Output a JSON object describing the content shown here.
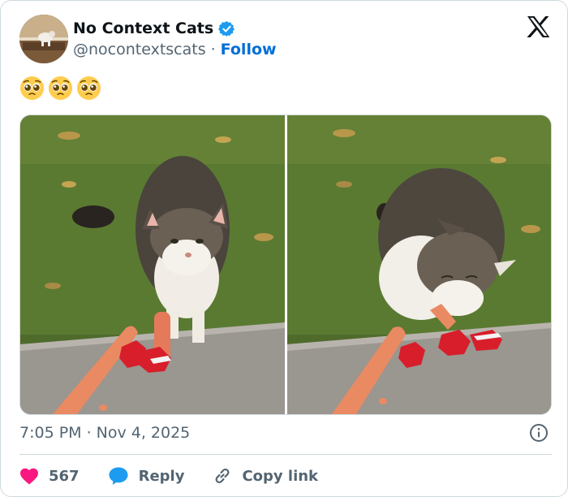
{
  "author": {
    "display_name": "No Context Cats",
    "handle": "@nocontextscats",
    "separator": "·",
    "follow_label": "Follow",
    "verified_color": "#1d9bf0"
  },
  "brand_icon": "x-logo-icon",
  "tweet": {
    "emojis": [
      "pleading-face-emoji",
      "pleading-face-emoji",
      "pleading-face-emoji"
    ]
  },
  "media": {
    "photos": [
      "cat-approaching-sausages-photo",
      "cat-eating-sausage-photo"
    ]
  },
  "meta": {
    "time": "7:05 PM",
    "separator": "·",
    "date": "Nov 4, 2025"
  },
  "actions": {
    "like_count": "567",
    "reply_label": "Reply",
    "copy_link_label": "Copy link",
    "like_color": "#f91880",
    "reply_color": "#1d9bf0"
  }
}
